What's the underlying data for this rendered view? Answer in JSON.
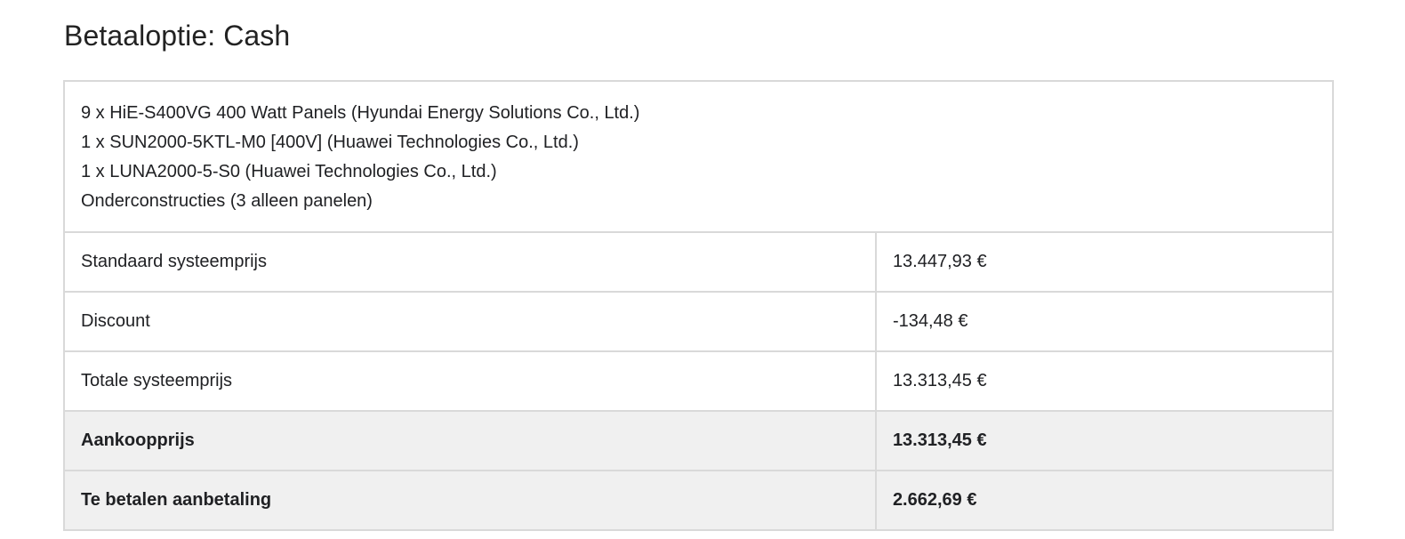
{
  "title": "Betaaloptie: Cash",
  "products": [
    "9 x HiE-S400VG 400 Watt Panels (Hyundai Energy Solutions Co., Ltd.)",
    "1 x SUN2000-5KTL-M0 [400V] (Huawei Technologies Co., Ltd.)",
    "1 x LUNA2000-5-S0 (Huawei Technologies Co., Ltd.)",
    "Onderconstructies (3 alleen panelen)"
  ],
  "rows": [
    {
      "label": "Standaard systeemprijs",
      "value": "13.447,93 €"
    },
    {
      "label": "Discount",
      "value": "-134,48 €"
    },
    {
      "label": "Totale systeemprijs",
      "value": "13.313,45 €"
    },
    {
      "label": "Aankoopprijs",
      "value": "13.313,45 €"
    },
    {
      "label": "Te betalen aanbetaling",
      "value": "2.662,69 €"
    }
  ]
}
